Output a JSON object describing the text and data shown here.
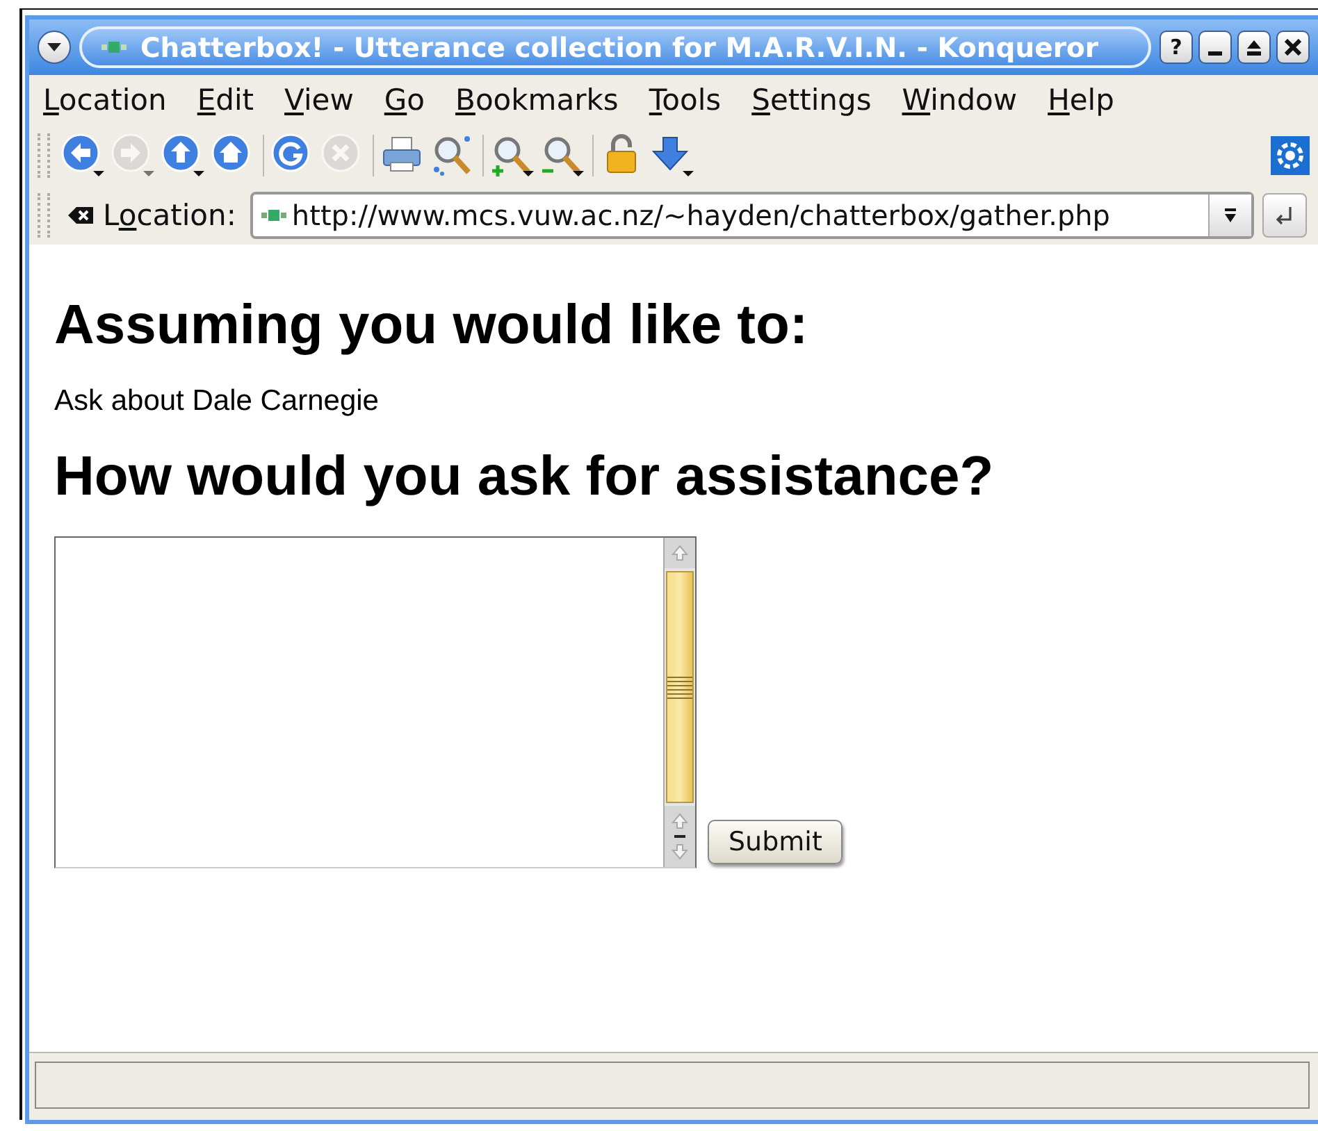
{
  "window": {
    "title": "Chatterbox! - Utterance collection for M.A.R.V.I.N. - Konqueror",
    "buttons": [
      {
        "kind": "help",
        "label": "?"
      },
      {
        "kind": "minimize"
      },
      {
        "kind": "maximize"
      },
      {
        "kind": "close"
      }
    ]
  },
  "menu": [
    {
      "accel": "L",
      "rest": "ocation"
    },
    {
      "accel": "E",
      "rest": "dit"
    },
    {
      "accel": "V",
      "rest": "iew"
    },
    {
      "accel": "G",
      "rest": "o"
    },
    {
      "accel": "B",
      "rest": "ookmarks"
    },
    {
      "accel": "T",
      "rest": "ools"
    },
    {
      "accel": "S",
      "rest": "ettings"
    },
    {
      "accel": "W",
      "rest": "indow"
    },
    {
      "accel": "H",
      "rest": "elp"
    }
  ],
  "toolbar": [
    [
      {
        "kind": "back",
        "disabled": false,
        "dropdown": true
      },
      {
        "kind": "forward",
        "disabled": true,
        "dropdown": true
      },
      {
        "kind": "up",
        "disabled": false,
        "dropdown": true
      },
      {
        "kind": "home",
        "disabled": false,
        "dropdown": false
      }
    ],
    [
      {
        "kind": "reload",
        "disabled": false,
        "dropdown": false
      },
      {
        "kind": "stop",
        "disabled": true,
        "dropdown": false
      }
    ],
    [
      {
        "kind": "print",
        "disabled": false,
        "dropdown": false
      },
      {
        "kind": "find",
        "disabled": false,
        "dropdown": false
      }
    ],
    [
      {
        "kind": "zoom-in",
        "disabled": false,
        "dropdown": true
      },
      {
        "kind": "zoom-out",
        "disabled": false,
        "dropdown": true
      }
    ],
    [
      {
        "kind": "lock",
        "disabled": false,
        "dropdown": false
      },
      {
        "kind": "download",
        "disabled": false,
        "dropdown": true
      }
    ]
  ],
  "location": {
    "parts": [
      "L",
      "o",
      "cation:"
    ],
    "url": "http://www.mcs.vuw.ac.nz/~hayden/chatterbox/gather.php"
  },
  "page": {
    "heading_1": "Assuming you would like to:",
    "intent": "Ask about Dale Carnegie",
    "heading_2": "How would you ask for assistance?",
    "submit": "Submit"
  }
}
